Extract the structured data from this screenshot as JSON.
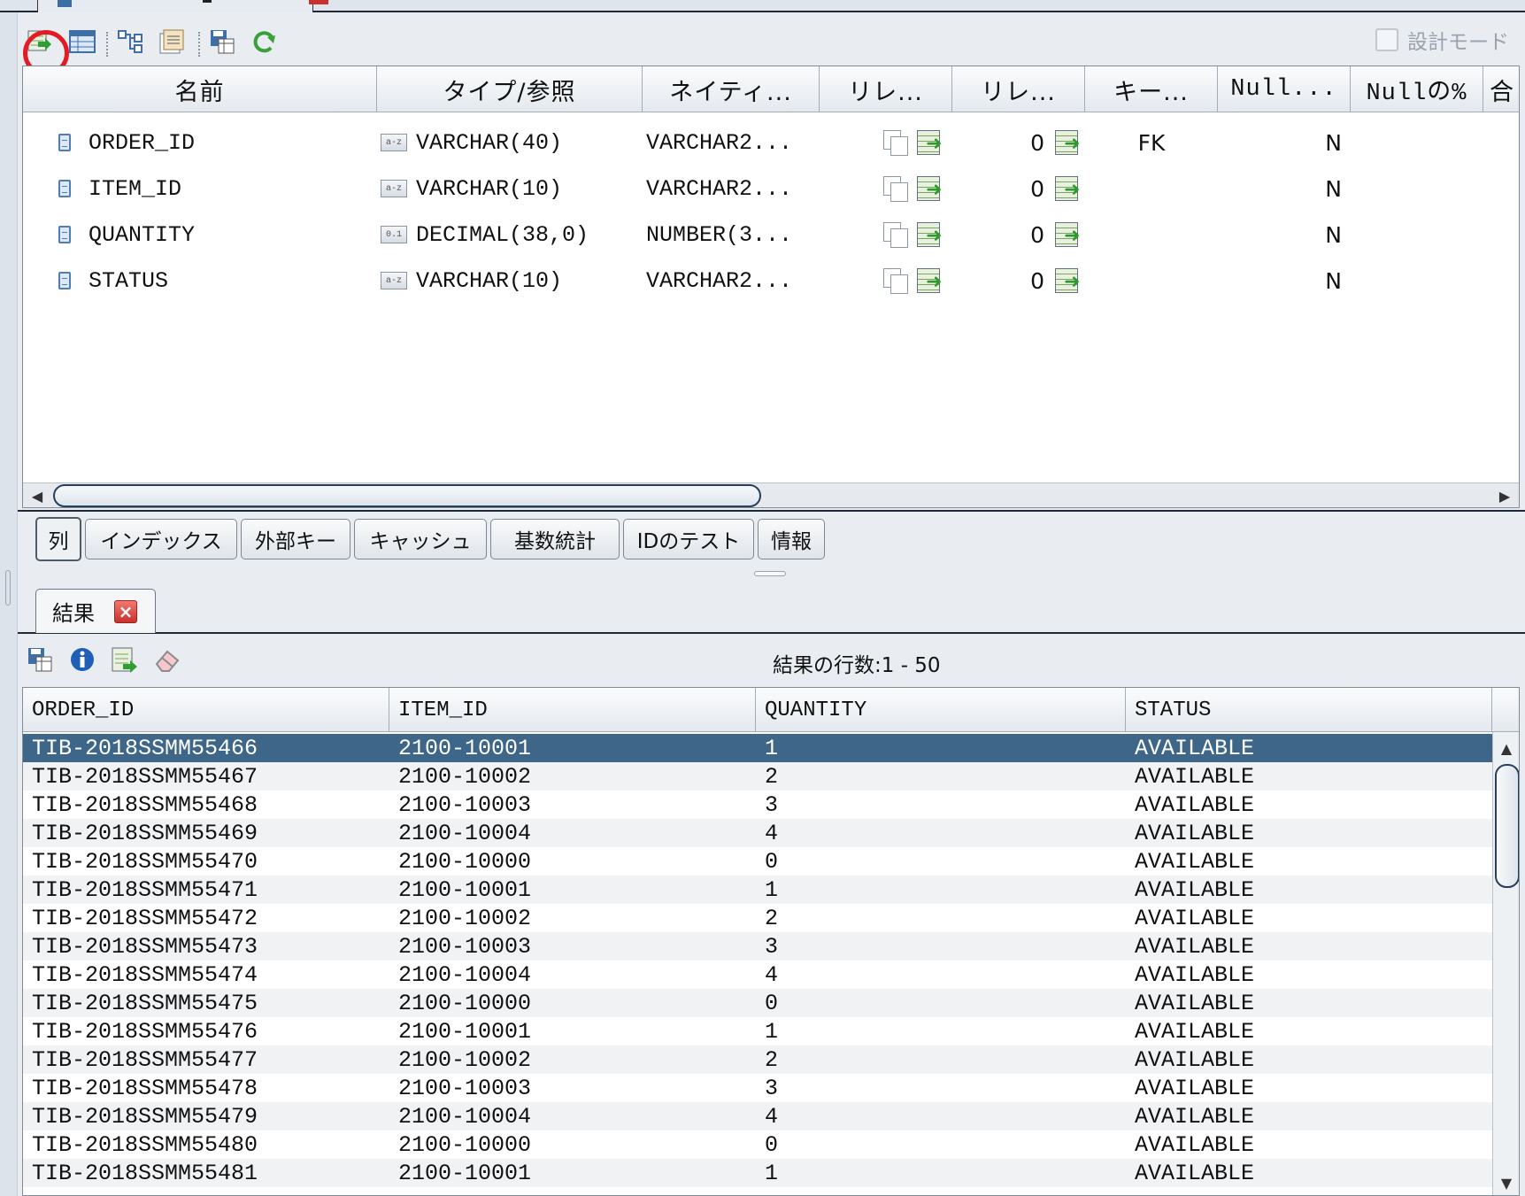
{
  "toolbar": {
    "design_mode_label": "設計モード"
  },
  "columns_grid": {
    "headers": [
      "名前",
      "タイプ/参照",
      "ネイティ...",
      "リレ...",
      "リレ...",
      "キー...",
      "Null...",
      "Nullの%",
      "合"
    ],
    "rows": [
      {
        "name": "ORDER_ID",
        "type_badge": "a-z",
        "type": "VARCHAR(40)",
        "native": "VARCHAR2...",
        "rel_count": "0",
        "key": "FK",
        "nullable": "N"
      },
      {
        "name": "ITEM_ID",
        "type_badge": "a-z",
        "type": "VARCHAR(10)",
        "native": "VARCHAR2...",
        "rel_count": "0",
        "key": "",
        "nullable": "N"
      },
      {
        "name": "QUANTITY",
        "type_badge": "0.1",
        "type": "DECIMAL(38,0)",
        "native": "NUMBER(3...",
        "rel_count": "0",
        "key": "",
        "nullable": "N"
      },
      {
        "name": "STATUS",
        "type_badge": "a-z",
        "type": "VARCHAR(10)",
        "native": "VARCHAR2...",
        "rel_count": "0",
        "key": "",
        "nullable": "N"
      }
    ]
  },
  "structure_tabs": [
    "列",
    "インデックス",
    "外部キー",
    "キャッシュ",
    "基数統計",
    "IDのテスト",
    "情報"
  ],
  "results": {
    "tab_label": "結果",
    "count_label": "結果の行数:1 - 50",
    "headers": [
      "ORDER_ID",
      "ITEM_ID",
      "QUANTITY",
      "STATUS"
    ],
    "rows": [
      [
        "TIB-2018SSMM55466",
        "2100-10001",
        "1",
        "AVAILABLE"
      ],
      [
        "TIB-2018SSMM55467",
        "2100-10002",
        "2",
        "AVAILABLE"
      ],
      [
        "TIB-2018SSMM55468",
        "2100-10003",
        "3",
        "AVAILABLE"
      ],
      [
        "TIB-2018SSMM55469",
        "2100-10004",
        "4",
        "AVAILABLE"
      ],
      [
        "TIB-2018SSMM55470",
        "2100-10000",
        "0",
        "AVAILABLE"
      ],
      [
        "TIB-2018SSMM55471",
        "2100-10001",
        "1",
        "AVAILABLE"
      ],
      [
        "TIB-2018SSMM55472",
        "2100-10002",
        "2",
        "AVAILABLE"
      ],
      [
        "TIB-2018SSMM55473",
        "2100-10003",
        "3",
        "AVAILABLE"
      ],
      [
        "TIB-2018SSMM55474",
        "2100-10004",
        "4",
        "AVAILABLE"
      ],
      [
        "TIB-2018SSMM55475",
        "2100-10000",
        "0",
        "AVAILABLE"
      ],
      [
        "TIB-2018SSMM55476",
        "2100-10001",
        "1",
        "AVAILABLE"
      ],
      [
        "TIB-2018SSMM55477",
        "2100-10002",
        "2",
        "AVAILABLE"
      ],
      [
        "TIB-2018SSMM55478",
        "2100-10003",
        "3",
        "AVAILABLE"
      ],
      [
        "TIB-2018SSMM55479",
        "2100-10004",
        "4",
        "AVAILABLE"
      ],
      [
        "TIB-2018SSMM55480",
        "2100-10000",
        "0",
        "AVAILABLE"
      ],
      [
        "TIB-2018SSMM55481",
        "2100-10001",
        "1",
        "AVAILABLE"
      ]
    ]
  },
  "colors": {
    "selection": "#3d6688",
    "highlight_circle": "#e21b24",
    "close_button": "#c9302c"
  }
}
